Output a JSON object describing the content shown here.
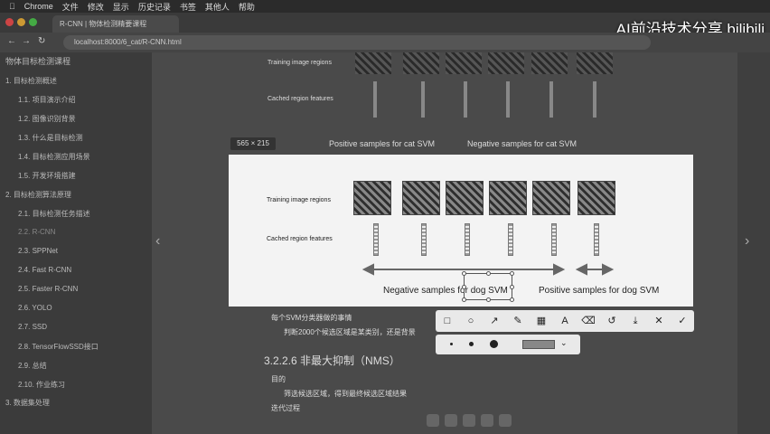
{
  "menubar": {
    "app": "Chrome",
    "items": [
      "文件",
      "修改",
      "显示",
      "历史记录",
      "书签",
      "其他人",
      "帮助"
    ]
  },
  "browser": {
    "tab_title": "R-CNN | 物体检测精要课程",
    "url": "localhost:8000/6_cat/R-CNN.html"
  },
  "watermark": "AI前沿技术分享 bilibili",
  "sidebar": {
    "title": "物体目标检测课程",
    "items": [
      "1. 目标检测概述",
      "1.1. 项目演示介绍",
      "1.2. 图像识别背景",
      "1.3. 什么是目标检测",
      "1.4. 目标检测应用场景",
      "1.5. 开发环境搭建",
      "2. 目标检测算法原理",
      "2.1. 目标检测任务描述",
      "2.2. R-CNN",
      "2.3. SPPNet",
      "2.4. Fast R-CNN",
      "2.5. Faster R-CNN",
      "2.6. YOLO",
      "2.7. SSD",
      "2.8. TensorFlowSSD接口",
      "2.9. 总结",
      "2.10. 作业练习",
      "3. 数据集处理"
    ]
  },
  "background_figure": {
    "row1_label": "Training image regions",
    "row2_label": "Cached region features",
    "caption_left": "Positive samples for cat SVM",
    "caption_right": "Negative samples for cat SVM"
  },
  "selection_size": "565 × 215",
  "screenshot_figure": {
    "row1_label": "Training image regions",
    "row2_label": "Cached region features",
    "caption_left": "Negative samples for dog SVM",
    "caption_right": "Positive samples for dog SVM"
  },
  "toolbar": {
    "tools": [
      "rectangle",
      "ellipse",
      "arrow",
      "pen",
      "mosaic",
      "A",
      "eraser",
      "undo",
      "download",
      "close",
      "confirm"
    ]
  },
  "doc": {
    "bullet1": "每个SVM分类器做的事情",
    "bullet2": "判断2000个候选区域是某类别，还是背景",
    "heading": "3.2.2.6 非最大抑制（NMS）",
    "bullet3": "目的",
    "bullet4": "筛选候选区域，得到最终候选区域结果",
    "bullet5": "迭代过程"
  }
}
